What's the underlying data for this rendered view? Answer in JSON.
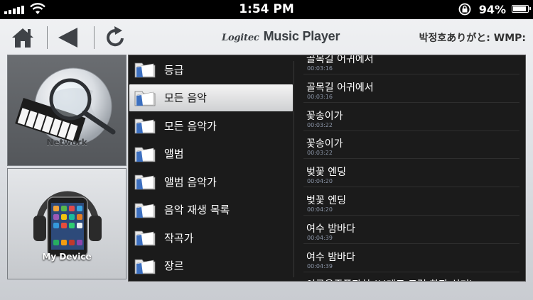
{
  "status_bar": {
    "time": "1:54 PM",
    "battery_percent": "94%",
    "battery_level": 0.94
  },
  "toolbar": {
    "icons": [
      "home-icon",
      "back-arrow-icon",
      "refresh-icon"
    ],
    "app_brand": "Logitec",
    "app_title": "Music Player",
    "server_name": "박정호ありがと: WMP:"
  },
  "sources": [
    {
      "label": "Network",
      "icon": "network-globe-piano-icon",
      "selected": true
    },
    {
      "label": "My Device",
      "icon": "device-headphones-icon",
      "selected": false
    }
  ],
  "categories": [
    {
      "label": "등급"
    },
    {
      "label": "모든 음악"
    },
    {
      "label": "모든 음악가"
    },
    {
      "label": "앨범"
    },
    {
      "label": "앨범 음악가"
    },
    {
      "label": "음악 재생 목록"
    },
    {
      "label": "작곡가"
    },
    {
      "label": "장르"
    }
  ],
  "selected_category_index": 1,
  "tracks": [
    {
      "title": "골목길 어귀에서",
      "duration": "00:03:16"
    },
    {
      "title": "골목길 어귀에서",
      "duration": "00:03:16"
    },
    {
      "title": "꽃송이가",
      "duration": "00:03:22"
    },
    {
      "title": "꽃송이가",
      "duration": "00:03:22"
    },
    {
      "title": "벚꽃 엔딩",
      "duration": "00:04:20"
    },
    {
      "title": "벚꽃 엔딩",
      "duration": "00:04:20"
    },
    {
      "title": "여수 밤바다",
      "duration": "00:04:39"
    },
    {
      "title": "여수 밤바다",
      "duration": "00:04:39"
    },
    {
      "title": "이름을좀폰잡혀 (브레드 드럼 한판 쉬기)",
      "duration": ""
    }
  ],
  "colors": {
    "status_bar_bg": "#000000",
    "list_bg": "#1b1b1b",
    "duration_text": "#8c96a8",
    "selected_row": "#e6e7e9"
  }
}
